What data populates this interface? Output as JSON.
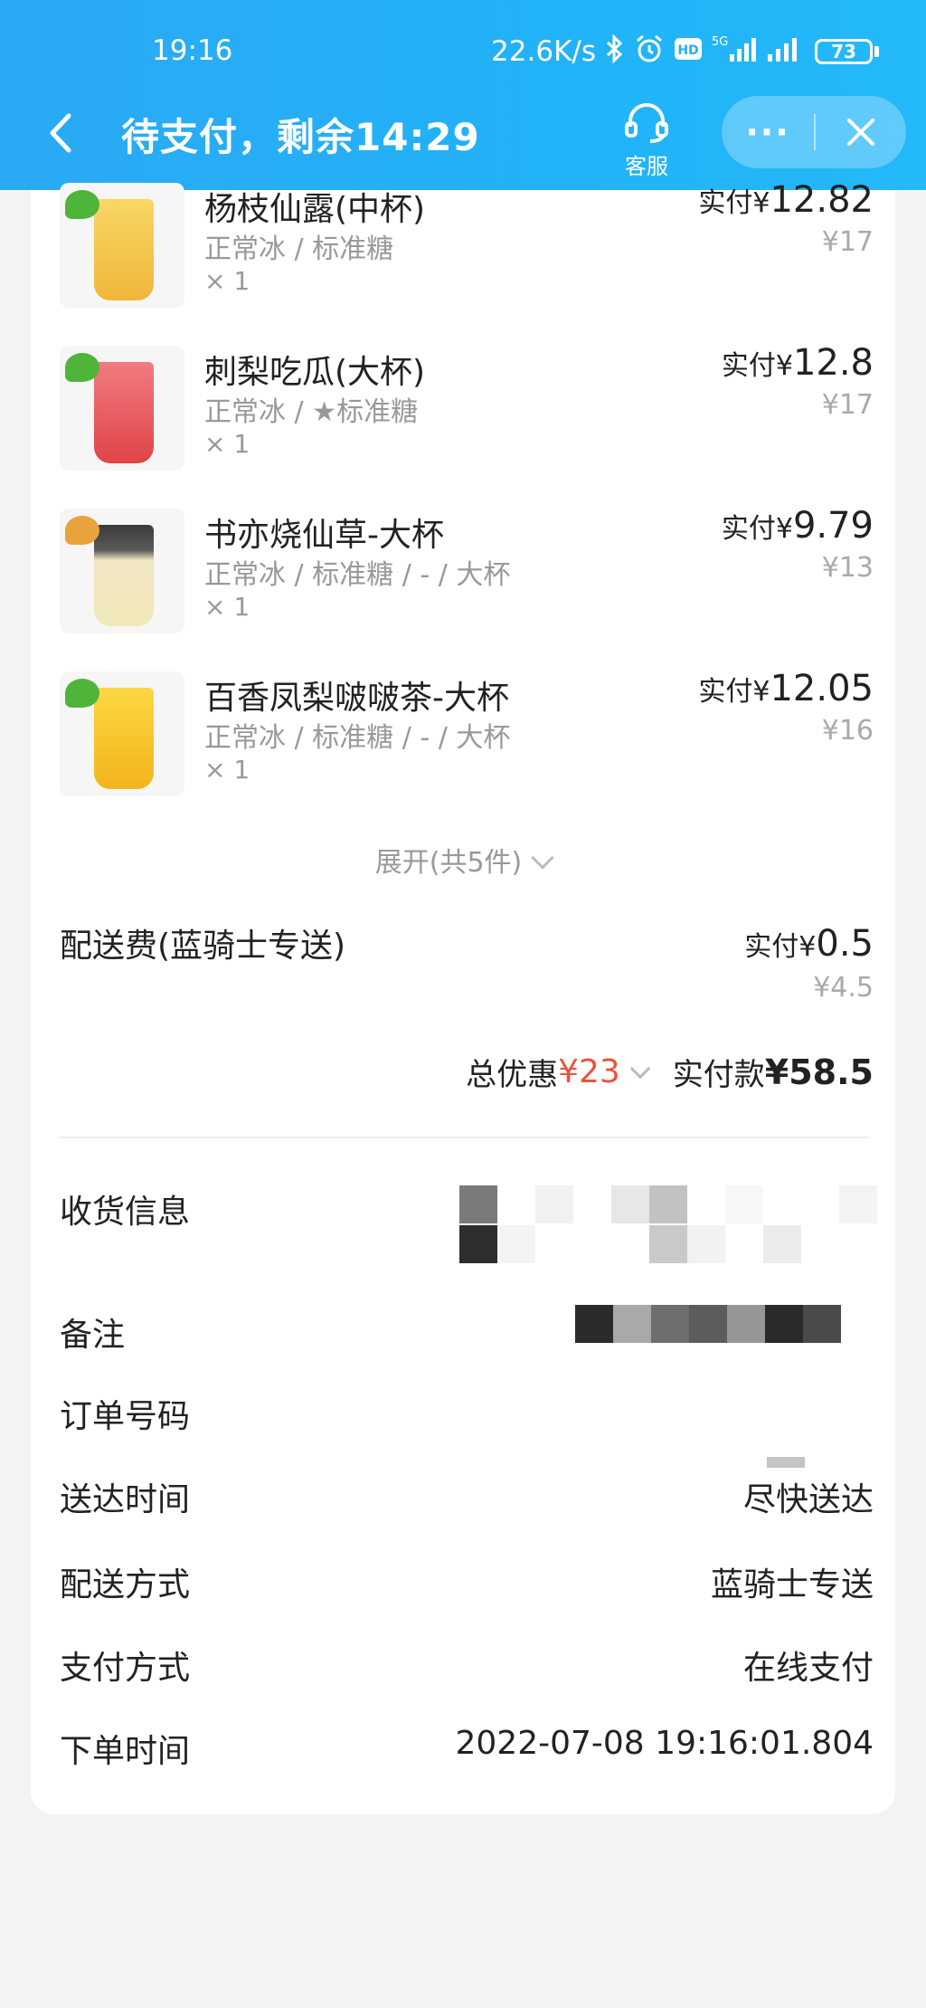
{
  "status_bar": {
    "time": "19:16",
    "net_speed": "22.6K/s",
    "battery": "73",
    "icons": [
      "bluetooth-icon",
      "alarm-icon",
      "hd-icon",
      "5g-signal-icon",
      "signal-icon"
    ]
  },
  "header": {
    "title": "待支付，剩余14:29",
    "service_label": "客服",
    "more_label": "···",
    "colors": {
      "header_bg": "#23b0f6",
      "text": "#ffffff"
    }
  },
  "items": [
    {
      "name": "杨枝仙露(中杯)",
      "spec": "正常冰 / 标准糖",
      "qty": "× 1",
      "pay_label": "实付",
      "currency": "¥",
      "pay_amount": "12.82",
      "original": "¥17",
      "cup_color": "#f5c64a"
    },
    {
      "name": "刺梨吃瓜(大杯)",
      "spec": "正常冰 / ★标准糖",
      "qty": "× 1",
      "pay_label": "实付",
      "currency": "¥",
      "pay_amount": "12.8",
      "original": "¥17",
      "cup_color": "#ef5f63"
    },
    {
      "name": "书亦烧仙草-大杯",
      "spec": "正常冰 / 标准糖 / - / 大杯",
      "qty": "× 1",
      "pay_label": "实付",
      "currency": "¥",
      "pay_amount": "9.79",
      "original": "¥13",
      "cup_color": "#e9dfb8"
    },
    {
      "name": "百香凤梨啵啵茶-大杯",
      "spec": "正常冰 / 标准糖 / - / 大杯",
      "qty": "× 1",
      "pay_label": "实付",
      "currency": "¥",
      "pay_amount": "12.05",
      "original": "¥16",
      "cup_color": "#f7c21d"
    }
  ],
  "expand_label": "展开(共5件)",
  "delivery_fee": {
    "label": "配送费(蓝骑士专送)",
    "pay_label": "实付",
    "currency": "¥",
    "pay_amount": "0.5",
    "original": "¥4.5"
  },
  "totals": {
    "discount_label": "总优惠",
    "discount_amount": "¥23",
    "paid_label": "实付款",
    "paid_amount": "¥58.5",
    "accent": "#e9543c"
  },
  "info": {
    "receiver_label": "收货信息",
    "remark_label": "备注",
    "order_no_label": "订单号码",
    "delivery_time_label": "送达时间",
    "delivery_time_value": "尽快送达",
    "delivery_method_label": "配送方式",
    "delivery_method_value": "蓝骑士专送",
    "payment_method_label": "支付方式",
    "payment_method_value": "在线支付",
    "order_time_label": "下单时间",
    "order_time_value": "2022-07-08 19:16:01.804"
  }
}
